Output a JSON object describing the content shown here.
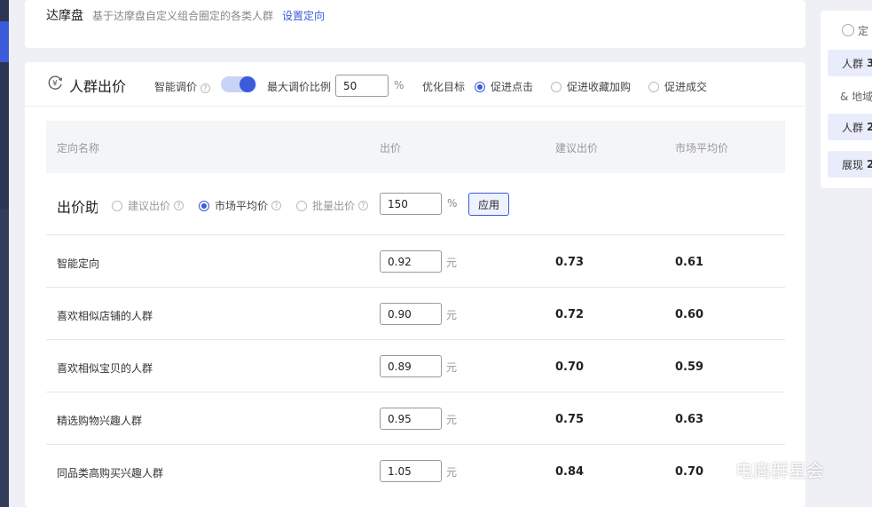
{
  "top": {
    "title": "达摩盘",
    "desc": "基于达摩盘自定义组合圈定的各类人群",
    "link": "设置定向"
  },
  "section": {
    "title": "人群出价",
    "smart_label": "智能调价",
    "smart_enabled": true,
    "max_label": "最大调价比例",
    "max_value": "50",
    "max_unit": "%",
    "target_label": "优化目标",
    "targets": [
      {
        "label": "促进点击",
        "selected": true
      },
      {
        "label": "促进收藏加购",
        "selected": false
      },
      {
        "label": "促进成交",
        "selected": false
      }
    ]
  },
  "table": {
    "headers": [
      "定向名称",
      "出价",
      "建议出价",
      "市场平均价"
    ],
    "batch": {
      "label": "出价助",
      "options": [
        {
          "label": "建议出价",
          "selected": false
        },
        {
          "label": "市场平均价",
          "selected": true
        },
        {
          "label": "批量出价",
          "selected": false
        }
      ],
      "value": "150",
      "unit": "%",
      "apply": "应用"
    },
    "unit_yuan": "元",
    "rows": [
      {
        "name": "智能定向",
        "bid": "0.92",
        "suggested": "0.73",
        "avg": "0.61"
      },
      {
        "name": "喜欢相似店铺的人群",
        "bid": "0.90",
        "suggested": "0.72",
        "avg": "0.60"
      },
      {
        "name": "喜欢相似宝贝的人群",
        "bid": "0.89",
        "suggested": "0.70",
        "avg": "0.59"
      },
      {
        "name": "精选购物兴趣人群",
        "bid": "0.95",
        "suggested": "0.75",
        "avg": "0.63"
      },
      {
        "name": "同品类高购买兴趣人群",
        "bid": "1.05",
        "suggested": "0.84",
        "avg": "0.70"
      }
    ]
  },
  "side": {
    "head": "定",
    "pill1_label": "人群",
    "pill1_value": "3",
    "plain": "& 地域",
    "pill2_label": "人群",
    "pill2_value": "2",
    "pill3_label": "展现",
    "pill3_value": "2"
  },
  "watermark": "电商群星会",
  "colors": {
    "accent": "#3b5bdb",
    "sidebar": "#2c3654"
  }
}
